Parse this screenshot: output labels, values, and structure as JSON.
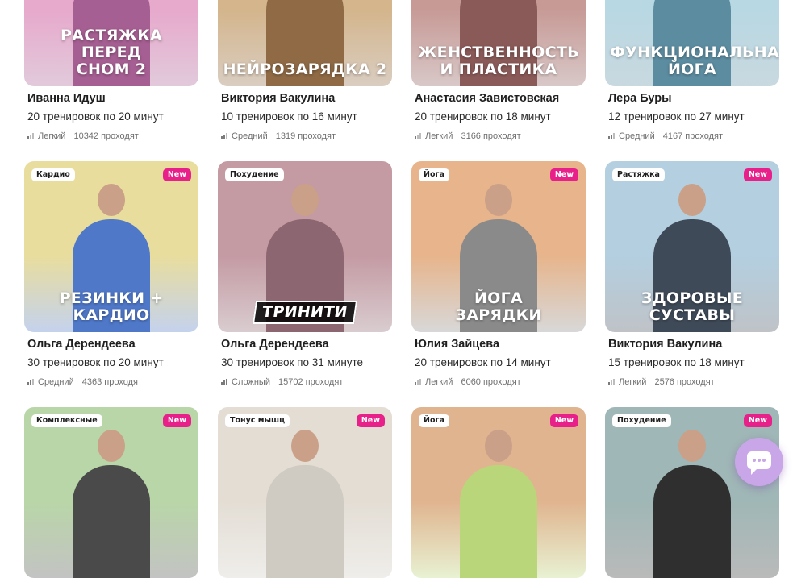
{
  "cards": [
    {
      "title": "РАСТЯЖКА ПЕРЕД\nСНОМ 2",
      "tag": "",
      "new": "",
      "name": "Иванна Идуш",
      "desc": "20 тренировок по 20 минут",
      "level": "Легкий",
      "level_bars": 1,
      "count": "10342 проходят",
      "bg": "#e7a9cc",
      "accent": "#a65f92"
    },
    {
      "title": "НЕЙРОЗАРЯДКА 2",
      "tag": "",
      "new": "",
      "name": "Виктория Вакулина",
      "desc": "10 тренировок по 16 минут",
      "level": "Средний",
      "level_bars": 2,
      "count": "1319 проходят",
      "bg": "#d4b58c",
      "accent": "#8f6a45"
    },
    {
      "title": "ЖЕНСТВЕННОСТЬ\nИ ПЛАСТИКА",
      "tag": "",
      "new": "",
      "name": "Анастасия Завистовская",
      "desc": "20 тренировок по 18 минут",
      "level": "Легкий",
      "level_bars": 1,
      "count": "3166 проходят",
      "bg": "#c79a96",
      "accent": "#8a5a58"
    },
    {
      "title": "ФУНКЦИОНАЛЬНАЯ\nЙОГА",
      "tag": "",
      "new": "",
      "name": "Лера Буры",
      "desc": "12 тренировок по 27 минут",
      "level": "Средний",
      "level_bars": 2,
      "count": "4167 проходят",
      "bg": "#b8d8e3",
      "accent": "#5c8ca0"
    },
    {
      "title": "РЕЗИНКИ +\nКАРДИО",
      "tag": "Кардио",
      "new": "New",
      "name": "Ольга Дерендеева",
      "desc": "30 тренировок по 20 минут",
      "level": "Средний",
      "level_bars": 2,
      "count": "4363 проходят",
      "bg": "#e9dd9d",
      "accent": "#4f78c8"
    },
    {
      "title": "ТРИНИТИ",
      "tag": "Похудение",
      "new": "",
      "name": "Ольга Дерендеева",
      "desc": "30 тренировок по 31 минуте",
      "level": "Сложный",
      "level_bars": 3,
      "count": "15702 проходят",
      "bg": "#c49aa3",
      "accent": "#8c6670"
    },
    {
      "title": "ЙОГА\nЗАРЯДКИ",
      "tag": "Йога",
      "new": "New",
      "name": "Юлия Зайцева",
      "desc": "20 тренировок по 14 минут",
      "level": "Легкий",
      "level_bars": 1,
      "count": "6060 проходят",
      "bg": "#e7b48b",
      "accent": "#8a8a8a"
    },
    {
      "title": "ЗДОРОВЫЕ\nСУСТАВЫ",
      "tag": "Растяжка",
      "new": "New",
      "name": "Виктория Вакулина",
      "desc": "15 тренировок по 18 минут",
      "level": "Легкий",
      "level_bars": 1,
      "count": "2576 проходят",
      "bg": "#b3cfe0",
      "accent": "#3f4a58"
    },
    {
      "title": "",
      "tag": "Комплексные",
      "new": "New",
      "name": "",
      "desc": "",
      "level": "",
      "level_bars": 0,
      "count": "",
      "bg": "#b9d6a8",
      "accent": "#4a4a4a"
    },
    {
      "title": "",
      "tag": "Тонус мышц",
      "new": "New",
      "name": "",
      "desc": "",
      "level": "",
      "level_bars": 0,
      "count": "",
      "bg": "#e3ddd4",
      "accent": "#d0cbc2"
    },
    {
      "title": "",
      "tag": "Йога",
      "new": "New",
      "name": "",
      "desc": "",
      "level": "",
      "level_bars": 0,
      "count": "",
      "bg": "#e0b48f",
      "accent": "#b9d77a"
    },
    {
      "title": "",
      "tag": "Похудение",
      "new": "New",
      "name": "",
      "desc": "",
      "level": "",
      "level_bars": 0,
      "count": "",
      "bg": "#9fb7b6",
      "accent": "#2f2f2f"
    }
  ],
  "chat_button": {
    "icon": "chat-icon"
  }
}
